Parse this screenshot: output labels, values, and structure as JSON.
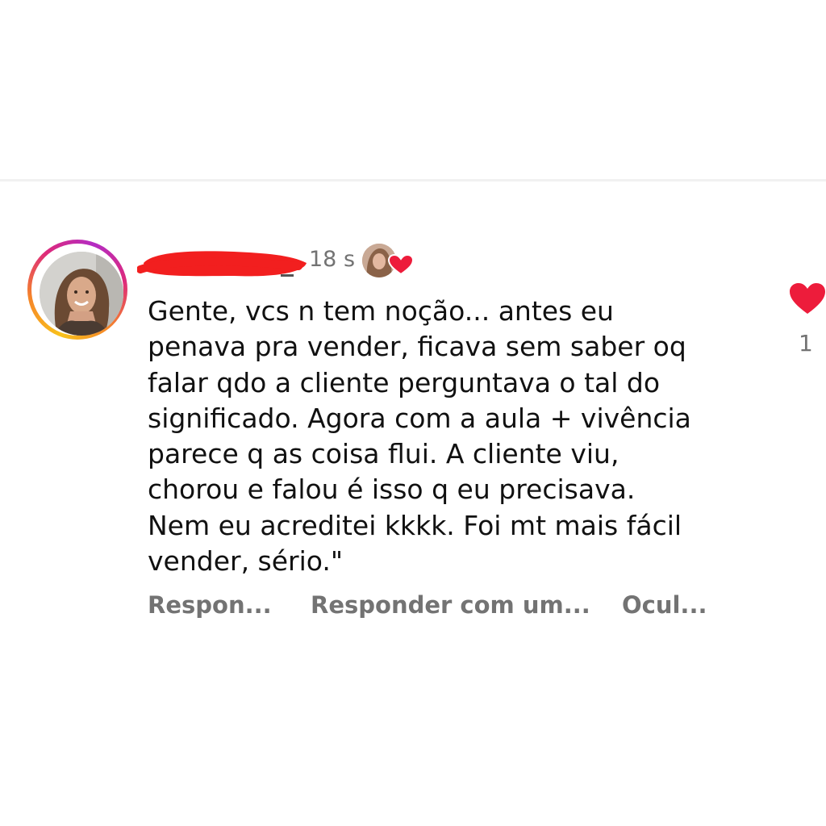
{
  "comment": {
    "timestamp": "18 s",
    "text": "Gente, vcs n tem noção... antes eu\npenava pra vender, ficava sem saber oq\nfalar qdo a cliente perguntava o tal do\nsignificado. Agora com a aula + vivência\nparece q as coisa flui. A cliente viu,\nchorou e falou é isso q eu precisava.\nNem eu acreditei kkkk. Foi mt mais fácil\nvender, sério.\"",
    "like_count": "1",
    "actions": {
      "reply": "Respon...",
      "reply_with": "Responder com um...",
      "hide": "Ocul..."
    }
  },
  "icons": {
    "like": "heart-icon",
    "author_like": "heart-icon"
  },
  "colors": {
    "heart": "#ed1c3b",
    "redaction": "#f21f1f",
    "meta_text": "#737373",
    "story_ring_start": "#f9c21b",
    "story_ring_end": "#b32cc4"
  }
}
